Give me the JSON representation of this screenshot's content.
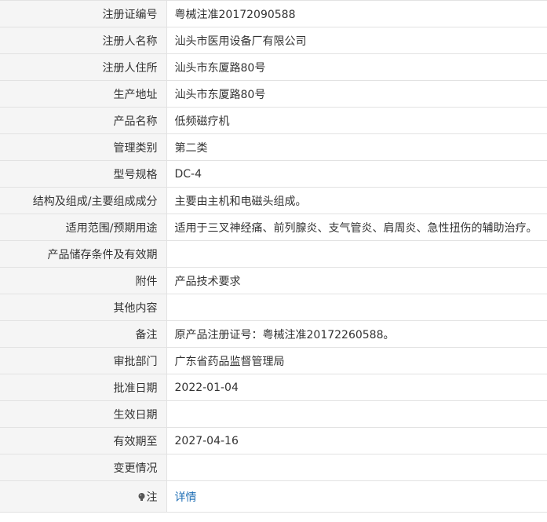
{
  "rows": [
    {
      "label": "注册证编号",
      "value": "粤械注准20172090588"
    },
    {
      "label": "注册人名称",
      "value": "汕头市医用设备厂有限公司"
    },
    {
      "label": "注册人住所",
      "value": "汕头市东厦路80号"
    },
    {
      "label": "生产地址",
      "value": "汕头市东厦路80号"
    },
    {
      "label": "产品名称",
      "value": "低频磁疗机"
    },
    {
      "label": "管理类别",
      "value": "第二类"
    },
    {
      "label": "型号规格",
      "value": "DC-4"
    },
    {
      "label": "结构及组成/主要组成成分",
      "value": "主要由主机和电磁头组成。"
    },
    {
      "label": "适用范围/预期用途",
      "value": "适用于三叉神经痛、前列腺炎、支气管炎、肩周炎、急性扭伤的辅助治疗。"
    },
    {
      "label": "产品储存条件及有效期",
      "value": ""
    },
    {
      "label": "附件",
      "value": "产品技术要求"
    },
    {
      "label": "其他内容",
      "value": ""
    },
    {
      "label": "备注",
      "value": "原产品注册证号：粤械注准20172260588。"
    },
    {
      "label": "审批部门",
      "value": "广东省药品监督管理局"
    },
    {
      "label": "批准日期",
      "value": "2022-01-04"
    },
    {
      "label": "生效日期",
      "value": ""
    },
    {
      "label": "有效期至",
      "value": "2027-04-16"
    },
    {
      "label": "变更情况",
      "value": ""
    }
  ],
  "note_row": {
    "icon": "lightbulb-icon",
    "label": "注",
    "link_text": "详情"
  },
  "colors": {
    "label_bg": "#f5f5f5",
    "border": "#e2e2e2",
    "text": "#333333",
    "link": "#1f6fb5"
  }
}
